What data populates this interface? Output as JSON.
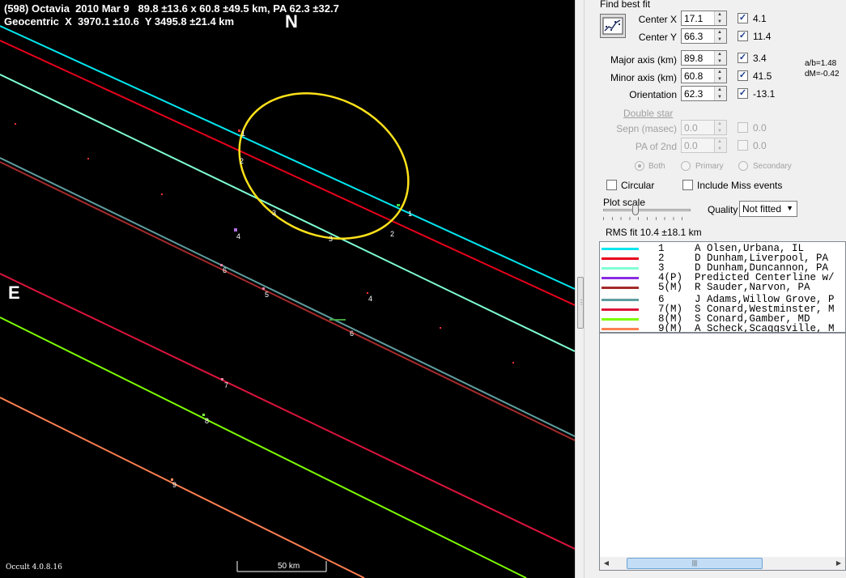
{
  "header": {
    "line1": "(598) Octavia  2010 Mar 9   89.8 ±13.6 x 60.8 ±49.5 km, PA 62.3 ±32.7",
    "line2": "Geocentric  X  3970.1 ±10.6  Y 3495.8 ±21.4 km"
  },
  "compass": {
    "north": "N",
    "east": "E"
  },
  "footer": {
    "version": "Occult 4.0.8.16",
    "scale_label": "50 km"
  },
  "chord_numbers": [
    "1",
    "2",
    "3",
    "4",
    "5",
    "6",
    "7",
    "8",
    "9"
  ],
  "panel": {
    "find_best_fit": "Find best fit",
    "fields": [
      {
        "label": "Center X",
        "value": "17.1",
        "checked": true,
        "unc": "4.1"
      },
      {
        "label": "Center Y",
        "value": "66.3",
        "checked": true,
        "unc": "11.4"
      },
      {
        "label": "Major axis (km)",
        "value": "89.8",
        "checked": true,
        "unc": "3.4"
      },
      {
        "label": "Minor axis (km)",
        "value": "60.8",
        "checked": true,
        "unc": "41.5"
      },
      {
        "label": "Orientation",
        "value": "62.3",
        "checked": true,
        "unc": "-13.1"
      }
    ],
    "ratio": "a/b=1.48",
    "dm": "dM=-0.42",
    "double_star": "Double star",
    "double_fields": [
      {
        "label": "Sepn (masec)",
        "value": "0.0",
        "unc": "0.0"
      },
      {
        "label": "PA of 2nd",
        "value": "0.0",
        "unc": "0.0"
      }
    ],
    "radios": [
      "Both",
      "Primary",
      "Secondary"
    ],
    "circular": "Circular",
    "include_miss": "Include Miss events",
    "plot_scale": "Plot scale",
    "quality_label": "Quality",
    "quality_value": "Not fitted",
    "rms": "RMS fit 10.4 ±18.1 km",
    "legend": [
      {
        "color": "#00e5ee",
        "text": "1     A Olsen,Urbana, IL"
      },
      {
        "color": "#e8001c",
        "text": "2     D Dunham,Liverpool, PA"
      },
      {
        "color": "#7fffd4",
        "text": "3     D Dunham,Duncannon, PA"
      },
      {
        "color": "#8a2be2",
        "text": "4(P)  Predicted Centerline w/"
      },
      {
        "color": "#a52a2a",
        "text": "5(M)  R Sauder,Narvon, PA"
      },
      {
        "color": "#5f9ea0",
        "text": "6     J Adams,Willow Grove, P"
      },
      {
        "color": "#dc143c",
        "text": "7(M)  S Conard,Westminster, M"
      },
      {
        "color": "#7cfc00",
        "text": "8(M)  S Conard,Gamber, MD"
      },
      {
        "color": "#ff7f50",
        "text": "9(M)  A Scheck,Scaggsville, M"
      }
    ]
  }
}
